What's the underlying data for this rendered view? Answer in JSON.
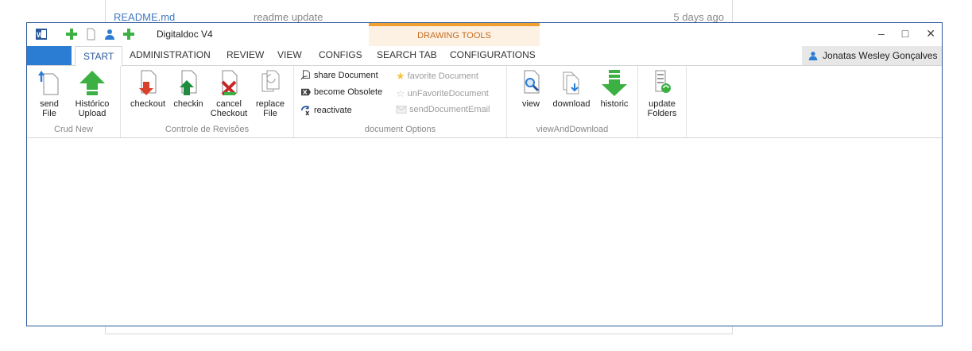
{
  "background": {
    "file_name": "README.md",
    "commit_message": "readme update",
    "age": "5 days ago"
  },
  "window": {
    "title": "Digitaldoc V4",
    "contextual_group": "DRAWING TOOLS",
    "controls": {
      "minimize": "–",
      "maximize": "□",
      "close": "✕"
    },
    "quick_access_icons": [
      "word-icon",
      "add-icon",
      "new-document-icon",
      "user-icon",
      "add-icon"
    ]
  },
  "tabs": {
    "active": "START",
    "items": [
      "START",
      "ADMINISTRATION",
      "REVIEW",
      "VIEW",
      "CONFIGS",
      "SEARCH TAB",
      "CONFIGURATIONS"
    ]
  },
  "user": {
    "name": "Jonatas Wesley Gonçalves"
  },
  "ribbon": {
    "crud_new": {
      "label": "Crud New",
      "send_file_line1": "send",
      "send_file_line2": "File",
      "historico_line1": "Histórico",
      "historico_line2": "Upload"
    },
    "controle": {
      "label": "Controle de Revisões",
      "checkout": "checkout",
      "checkin": "checkin",
      "cancel_line1": "cancel",
      "cancel_line2": "Checkout",
      "replace_line1": "replace",
      "replace_line2": "File"
    },
    "document_options": {
      "label": "document Options",
      "share": "share Document",
      "obsolete": "become Obsolete",
      "reactivate": "reactivate",
      "favorite": "favorite Document",
      "unfavorite": "unFavoriteDocument",
      "send_email": "sendDocumentEmail"
    },
    "view_download": {
      "label": "viewAndDownload",
      "view": "view",
      "download": "download",
      "historic": "historic"
    },
    "update": {
      "line1": "update",
      "line2": "Folders"
    }
  },
  "colors": {
    "accent": "#2b579a",
    "file_tab": "#2b7cd3",
    "green_arrow": "#3cb043",
    "red_arrow": "#d9402b",
    "context_orange": "#f0a030"
  }
}
